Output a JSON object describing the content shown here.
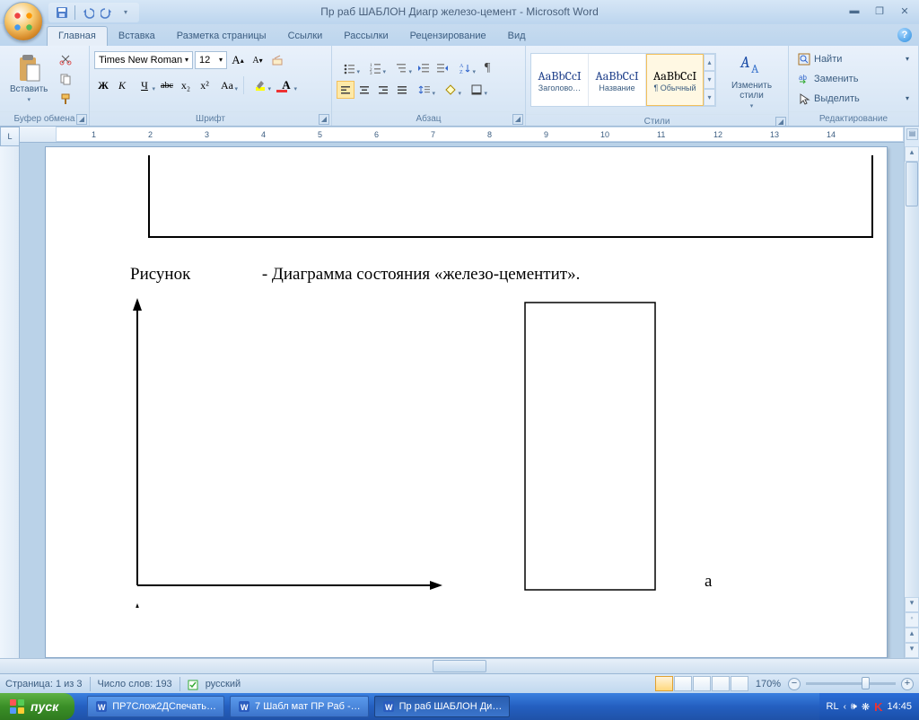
{
  "app_title": "Пр раб ШАБЛОН Диагр железо-цемент - Microsoft Word",
  "tabs": {
    "home": "Главная",
    "insert": "Вставка",
    "layout": "Разметка страницы",
    "refs": "Ссылки",
    "mail": "Рассылки",
    "review": "Рецензирование",
    "view": "Вид"
  },
  "groups": {
    "clipboard": "Буфер обмена",
    "font": "Шрифт",
    "paragraph": "Абзац",
    "styles": "Стили",
    "editing": "Редактирование"
  },
  "clipboard": {
    "paste": "Вставить"
  },
  "font": {
    "name": "Times New Roman",
    "size": "12",
    "bold": "Ж",
    "italic": "К",
    "underline": "Ч",
    "strike": "abc",
    "sub": "x₂",
    "sup": "x²",
    "case": "Aa"
  },
  "styles": {
    "preview": "AaBbCcI",
    "preview2": "AaBbCcI",
    "preview3": "AaBbCcI",
    "heading": "Заголово…",
    "name": "Название",
    "normal": "¶ Обычный",
    "change": "Изменить стили"
  },
  "editing": {
    "find": "Найти",
    "replace": "Заменить",
    "select": "Выделить"
  },
  "ruler_marks": [
    "1",
    "2",
    "3",
    "4",
    "5",
    "6",
    "7",
    "8",
    "9",
    "10",
    "11",
    "12",
    "13",
    "14"
  ],
  "document": {
    "caption_prefix": "Рисунок",
    "caption_main": "- Диаграмма состояния «железо-цементит».",
    "letter_a": "а"
  },
  "statusbar": {
    "page": "Страница: 1 из 3",
    "words": "Число слов: 193",
    "lang": "русский",
    "zoom": "170%"
  },
  "taskbar": {
    "start": "пуск",
    "item1": "ПР7Слож2ДСпечать…",
    "item2": "7 Шабл мат ПР Раб -…",
    "item3": "Пр раб ШАБЛОН Ди…",
    "lang": "RL",
    "time": "14:45"
  }
}
